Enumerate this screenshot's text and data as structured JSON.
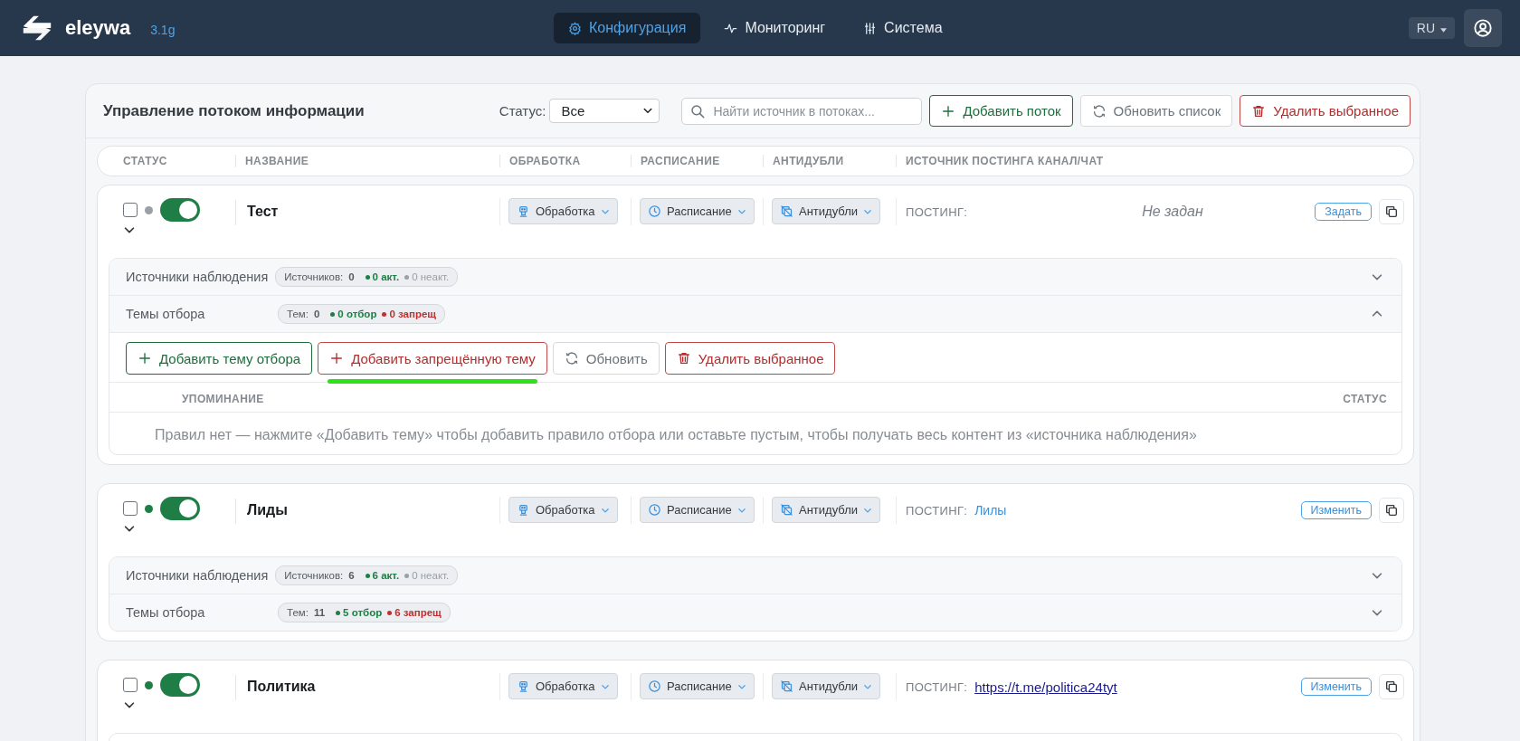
{
  "app": {
    "name": "eleywa",
    "version": "3.1g"
  },
  "nav": [
    {
      "label": "Конфигурация",
      "selected": true
    },
    {
      "label": "Мониторинг",
      "selected": false
    },
    {
      "label": "Система",
      "selected": false
    }
  ],
  "language": "RU",
  "toolbar": {
    "title": "Управление потоком информации",
    "status_label": "Статус:",
    "status_value": "Все",
    "search_placeholder": "Найти источник в потоках...",
    "buttons": [
      {
        "label": "Добавить поток",
        "kind": "add"
      },
      {
        "label": "Обновить список",
        "kind": "refresh"
      },
      {
        "label": "Удалить выбранное",
        "kind": "delete"
      }
    ]
  },
  "columns": [
    "СТАТУС",
    "НАЗВАНИЕ",
    "ОБРАБОТКА",
    "РАСПИСАНИЕ",
    "АНТИДУБЛИ",
    "ИСТОЧНИК ПОСТИНГА КАНАЛ/ЧАТ"
  ],
  "flows": [
    {
      "name": "Тест",
      "kind": "unset",
      "checked": false,
      "color": "#9aa0a6",
      "on": true,
      "menus": [
        "Обработка",
        "Расписание",
        "Антидубли"
      ],
      "posting_label": "ПОСТИНГ:",
      "posting_value": "Не задан",
      "action": "Задать",
      "sections": [
        {
          "kind": "sources",
          "label": "Источники наблюдения",
          "count_label": "Источников:",
          "count": "0",
          "good": "0 акт.",
          "bad": "0 неакт.",
          "expanded": false
        },
        {
          "kind": "topics",
          "label": "Темы отбора",
          "count_label": "Тем:",
          "count": "0",
          "good": "0 отбор",
          "bad": "0 запрещ",
          "expanded": true,
          "buttons": [
            {
              "label": "Добавить тему отбора",
              "kind": "add",
              "highlighted": false
            },
            {
              "label": "Добавить запрещённую тему",
              "kind": "add-deny",
              "highlighted": true
            },
            {
              "label": "Обновить",
              "kind": "refresh",
              "highlighted": false
            },
            {
              "label": "Удалить выбранное",
              "kind": "delete",
              "highlighted": false
            }
          ],
          "table_columns": [
            "УПОМИНАНИЕ",
            "СТАТУС"
          ],
          "empty": "Правил нет — нажмите «Добавить тему» чтобы добавить правило отбора или оставьте пустым, чтобы получать весь контент из «источника наблюдения»"
        }
      ]
    },
    {
      "name": "Лиды",
      "kind": "name",
      "checked": false,
      "color": "#1e7e45",
      "on": true,
      "menus": [
        "Обработка",
        "Расписание",
        "Антидубли"
      ],
      "posting_label": "ПОСТИНГ:",
      "posting_value": "Лилы",
      "action": "Изменить",
      "sections": [
        {
          "kind": "sources",
          "label": "Источники наблюдения",
          "count_label": "Источников:",
          "count": "6",
          "good": "6 акт.",
          "bad": "0 неакт.",
          "expanded": false
        },
        {
          "kind": "topics",
          "label": "Темы отбора",
          "count_label": "Тем:",
          "count": "11",
          "good": "5 отбор",
          "bad": "6 запрещ",
          "expanded": false
        }
      ]
    },
    {
      "name": "Политика",
      "kind": "link",
      "checked": false,
      "color": "#1e7e45",
      "on": true,
      "menus": [
        "Обработка",
        "Расписание",
        "Антидубли"
      ],
      "posting_label": "ПОСТИНГ:",
      "posting_value": "https://t.me/politica24tyt",
      "action": "Изменить"
    }
  ]
}
